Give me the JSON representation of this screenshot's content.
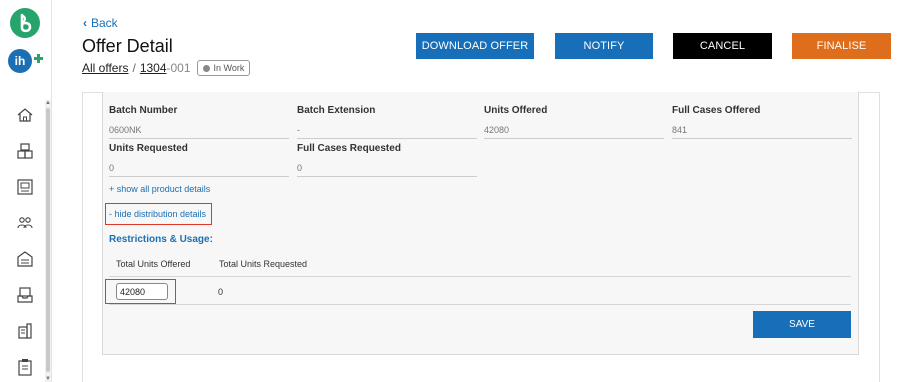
{
  "header": {
    "back_label": "Back",
    "title": "Offer Detail",
    "breadcrumb": {
      "all_offers": "All offers",
      "separator": "/",
      "offer_id": "1304",
      "offer_suffix": "-001",
      "status": "In Work"
    }
  },
  "actions": {
    "download": "DOWNLOAD OFFER",
    "notify": "NOTIFY",
    "cancel": "CANCEL",
    "finalise": "FINALISE"
  },
  "fields": [
    {
      "label": "Batch Number",
      "value": "0600NK"
    },
    {
      "label": "Batch Extension",
      "value": "-"
    },
    {
      "label": "Units Offered",
      "value": "42080"
    },
    {
      "label": "Full Cases Offered",
      "value": "841"
    },
    {
      "label": "Units Requested",
      "value": "0"
    },
    {
      "label": "Full Cases Requested",
      "value": "0"
    }
  ],
  "links": {
    "show_product": "+ show all product details",
    "hide_distribution": "- hide distribution details"
  },
  "restrictions": {
    "title": "Restrictions & Usage:",
    "col_offered": "Total Units Offered",
    "col_requested": "Total Units Requested",
    "offered_value": "42080",
    "requested_value": "0"
  },
  "save_label": "SAVE",
  "colors": {
    "primary": "#166fb8",
    "cancel": "#000000",
    "finalise": "#de6d1c",
    "highlight": "#e0392b",
    "brand_green": "#27a36c"
  },
  "sidebar_icons": [
    "home-icon",
    "boxes-icon",
    "catalog-icon",
    "group-icon",
    "warehouse-icon",
    "inbox-icon",
    "building-icon",
    "clipboard-icon"
  ]
}
